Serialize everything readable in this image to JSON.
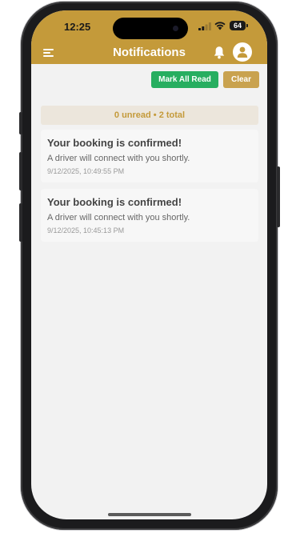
{
  "status_bar": {
    "time": "12:25",
    "battery": "64"
  },
  "header": {
    "title": "Notifications",
    "menu_icon": "hamburger-menu-icon",
    "bell_icon": "bell-icon",
    "avatar_icon": "user-avatar-icon",
    "background_color": "#c49a3a"
  },
  "actions": {
    "mark_all_read_label": "Mark All Read",
    "clear_label": "Clear",
    "mark_all_color": "#27ae60",
    "clear_color": "#c9a24f"
  },
  "summary": {
    "text": "0 unread • 2 total"
  },
  "notifications": [
    {
      "title": "Your booking is confirmed!",
      "message": "A driver will connect with you shortly.",
      "timestamp": "9/12/2025, 10:49:55 PM"
    },
    {
      "title": "Your booking is confirmed!",
      "message": "A driver will connect with you shortly.",
      "timestamp": "9/12/2025, 10:45:13 PM"
    }
  ]
}
